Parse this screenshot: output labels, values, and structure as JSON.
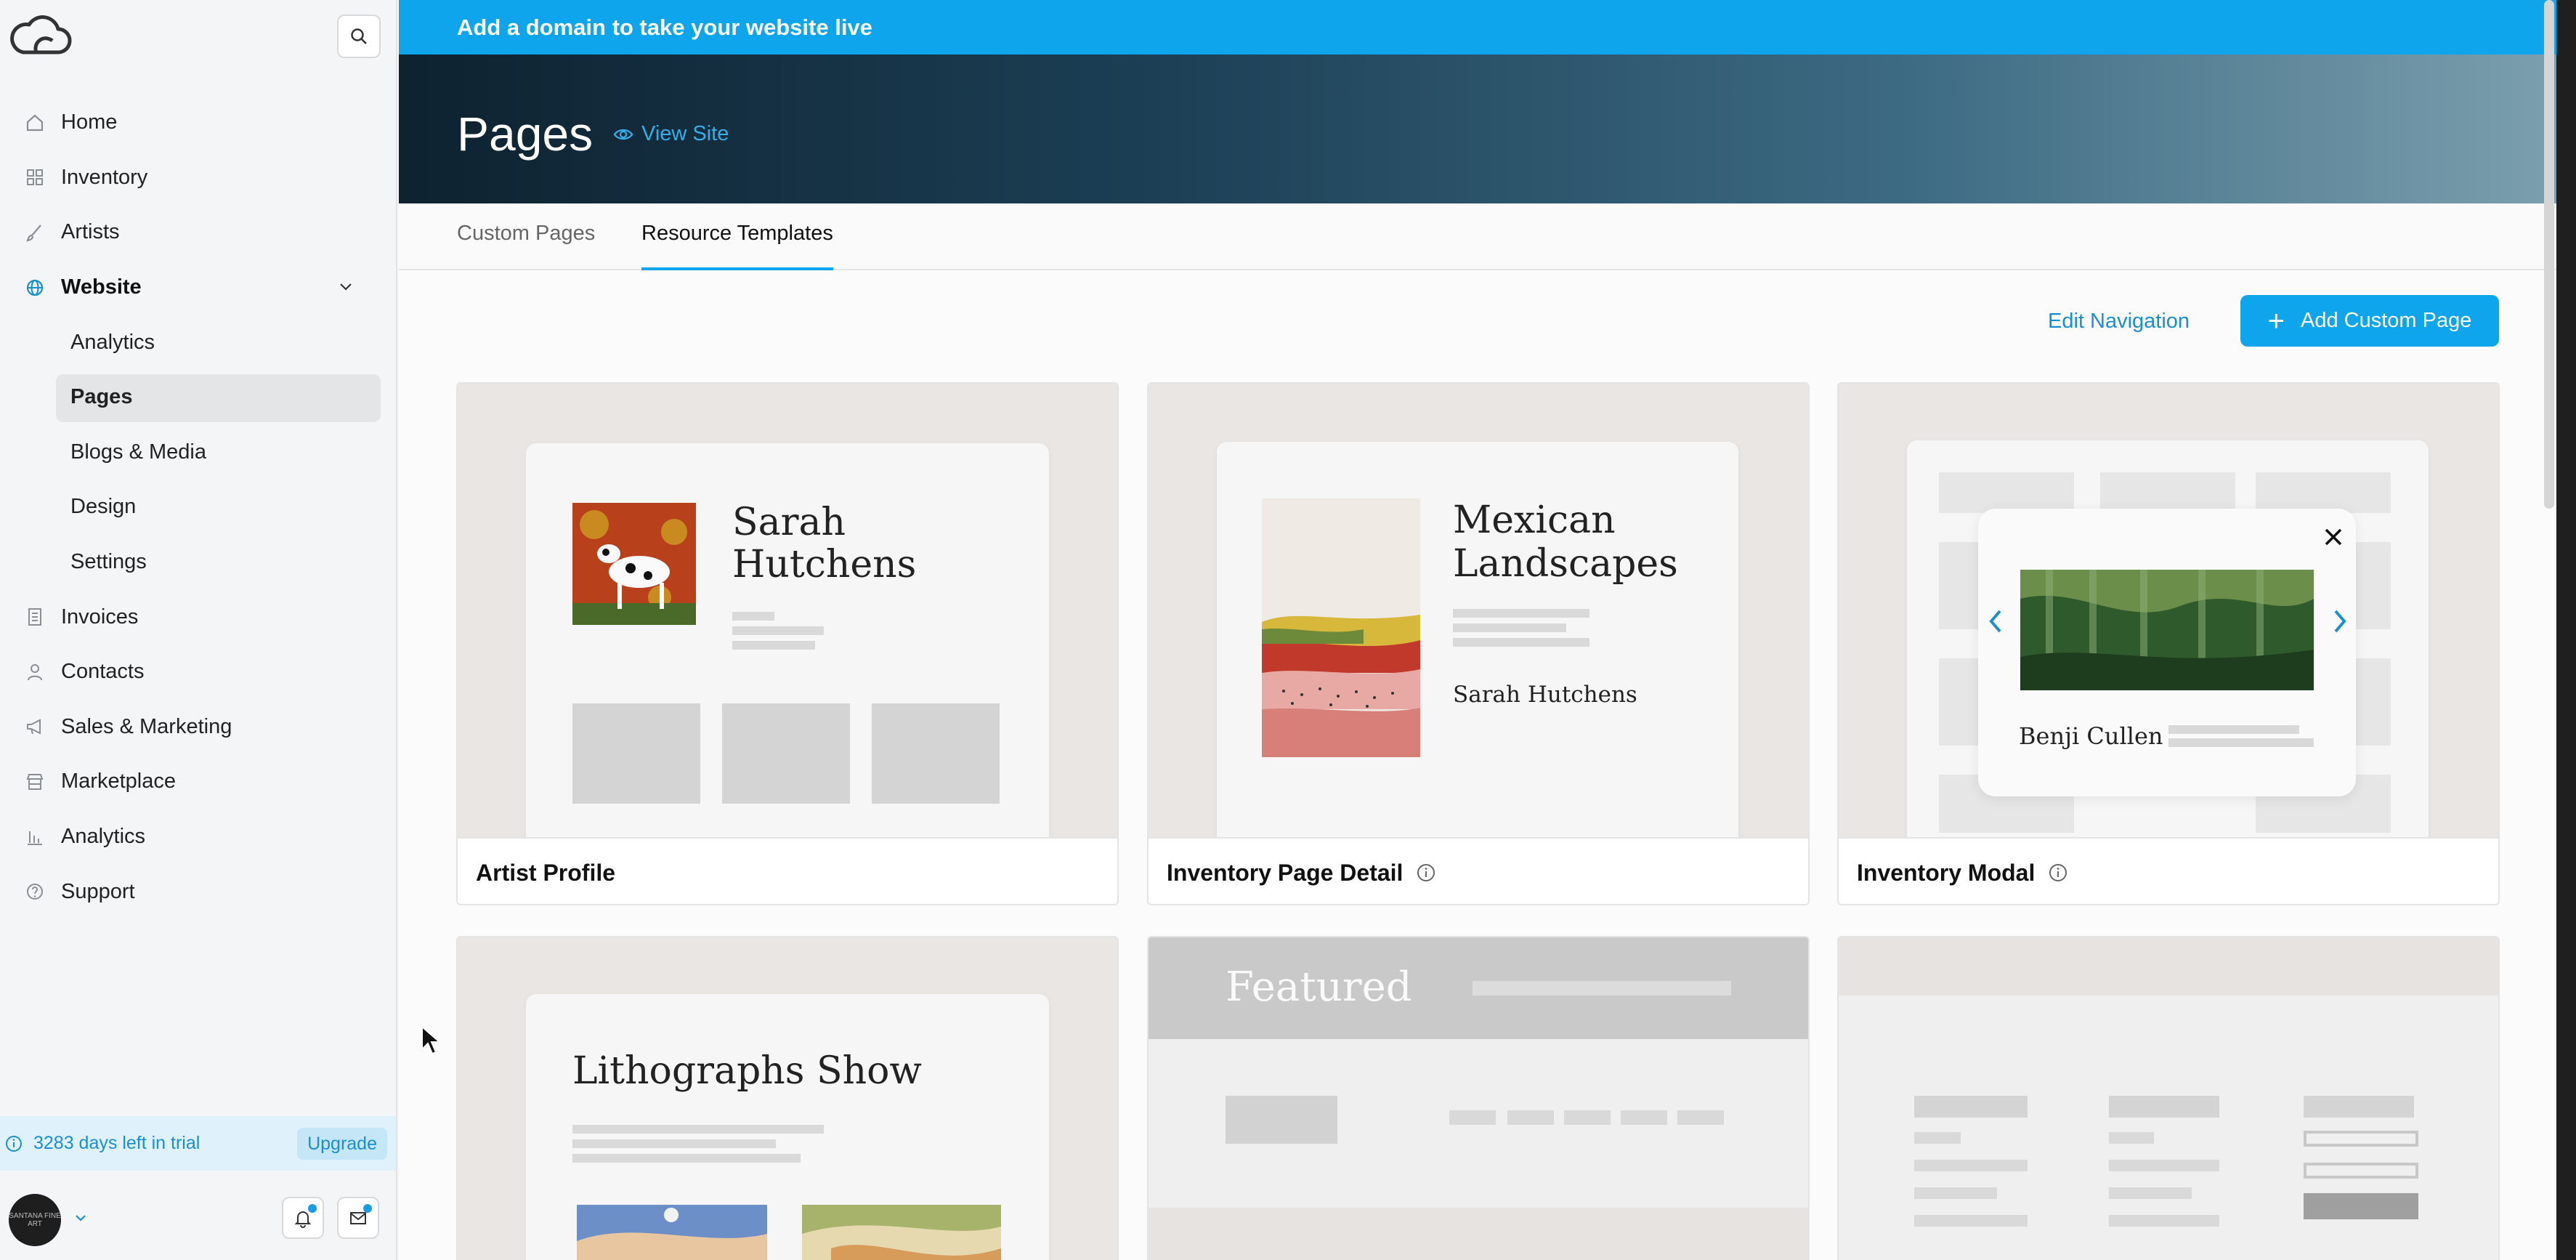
{
  "announcement": "Add a domain to take your website live",
  "page": {
    "title": "Pages",
    "view_site": "View Site"
  },
  "tabs": [
    "Custom Pages",
    "Resource Templates"
  ],
  "actions": {
    "edit_navigation": "Edit Navigation",
    "add_custom_page": "Add Custom Page"
  },
  "sidebar": {
    "items": [
      {
        "label": "Home",
        "icon": "home-icon"
      },
      {
        "label": "Inventory",
        "icon": "grid-icon"
      },
      {
        "label": "Artists",
        "icon": "brush-icon"
      },
      {
        "label": "Website",
        "icon": "globe-icon"
      },
      {
        "label": "Invoices",
        "icon": "invoice-icon"
      },
      {
        "label": "Contacts",
        "icon": "person-icon"
      },
      {
        "label": "Sales & Marketing",
        "icon": "megaphone-icon"
      },
      {
        "label": "Marketplace",
        "icon": "store-icon"
      },
      {
        "label": "Analytics",
        "icon": "bar-chart-icon"
      },
      {
        "label": "Support",
        "icon": "help-icon"
      }
    ],
    "website_sub": [
      "Analytics",
      "Pages",
      "Blogs & Media",
      "Design",
      "Settings"
    ],
    "trial_text": "3283 days left in trial",
    "upgrade": "Upgrade",
    "avatar_text": "SANTANA FINE ART"
  },
  "cards": [
    {
      "title": "Artist Profile",
      "preview_heading": "Sarah Hutchens",
      "has_info": false
    },
    {
      "title": "Inventory Page Detail",
      "preview_heading": "Mexican Landscapes",
      "preview_sub": "Sarah Hutchens",
      "has_info": true
    },
    {
      "title": "Inventory Modal",
      "preview_heading": "Benji Cullen",
      "has_info": true
    },
    {
      "title": "",
      "preview_heading": "Lithographs Show"
    },
    {
      "title": "",
      "preview_heading": "Featured"
    },
    {
      "title": ""
    }
  ],
  "colors": {
    "accent": "#0ea5ec",
    "link": "#1a8fd0"
  }
}
